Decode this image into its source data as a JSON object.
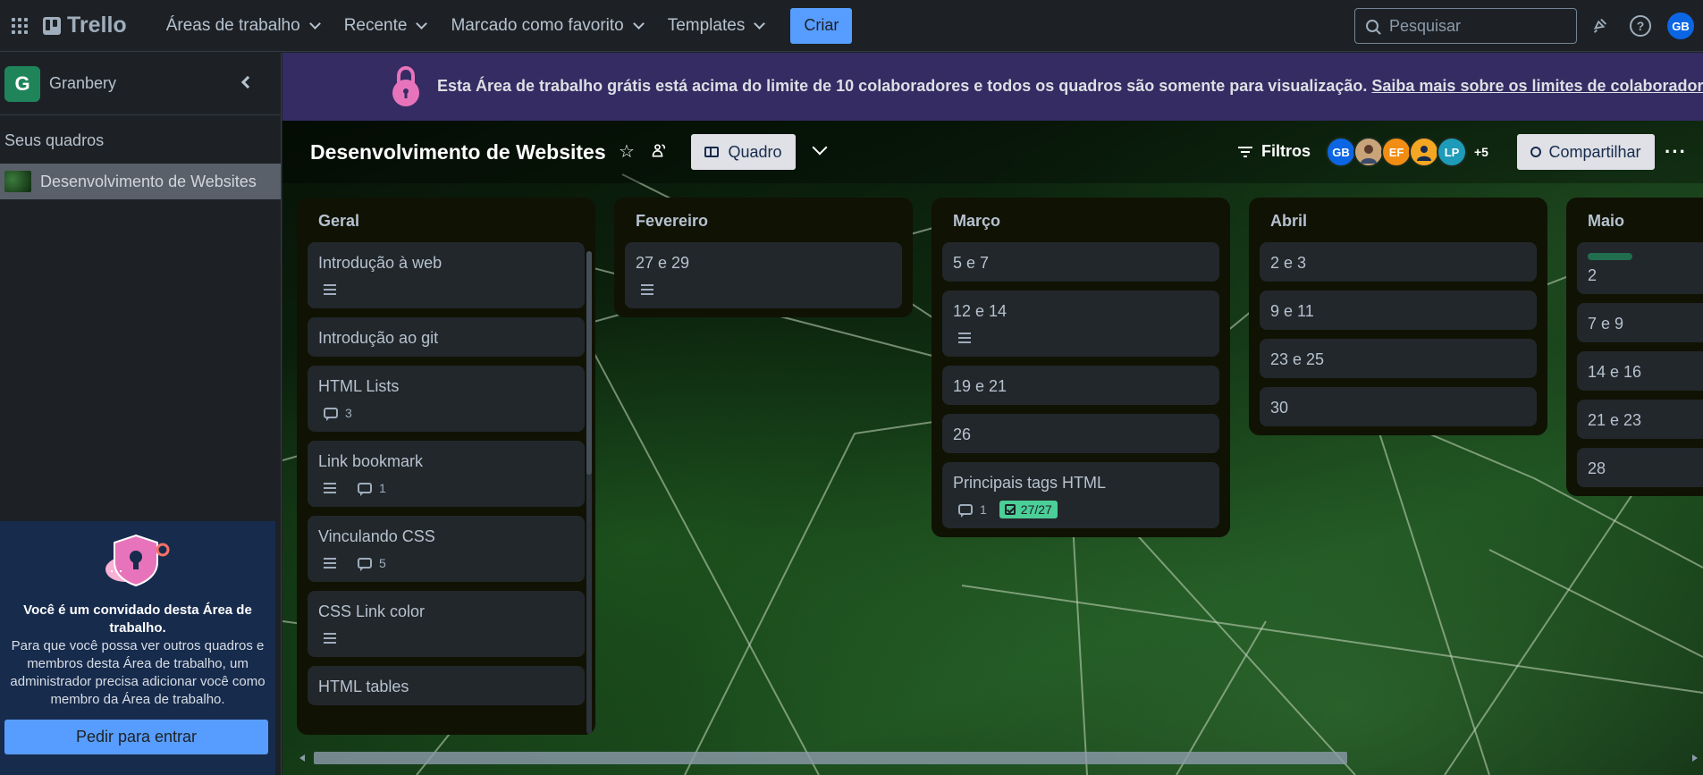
{
  "topbar": {
    "logo": "Trello",
    "menu": [
      {
        "label": "Áreas de trabalho"
      },
      {
        "label": "Recente"
      },
      {
        "label": "Marcado como favorito"
      },
      {
        "label": "Templates"
      }
    ],
    "create_label": "Criar",
    "search_placeholder": "Pesquisar",
    "user_initials": "GB"
  },
  "sidebar": {
    "workspace_initial": "G",
    "workspace_name": "Granbery",
    "section_title": "Seus quadros",
    "boards": [
      {
        "label": "Desenvolvimento de Websites"
      }
    ],
    "guest": {
      "title": "Você é um convidado desta Área de trabalho.",
      "text": "Para que você possa ver outros quadros e membros desta Área de trabalho, um administrador precisa adicionar você como membro da Área de trabalho.",
      "button": "Pedir para entrar"
    }
  },
  "banner": {
    "text": "Esta Área de trabalho grátis está acima do limite de 10 colaboradores e todos os quadros são somente para visualização.",
    "link": "Saiba mais sobre os limites de colaboradores"
  },
  "board": {
    "title": "Desenvolvimento de Websites",
    "view_label": "Quadro",
    "filters_label": "Filtros",
    "members": [
      {
        "initials": "GB",
        "color": "#0c66e4"
      },
      {
        "initials": "",
        "color": "#c9a37a"
      },
      {
        "initials": "EF",
        "color": "#f18d13"
      },
      {
        "initials": "",
        "color": "#f5a623"
      },
      {
        "initials": "LP",
        "color": "#1d9bb8"
      }
    ],
    "more_members": "+5",
    "share_label": "Compartilhar"
  },
  "lists": [
    {
      "title": "Geral",
      "cards": [
        {
          "title": "Introdução à web",
          "description": true
        },
        {
          "title": "Introdução ao git"
        },
        {
          "title": "HTML Lists",
          "comments": "3"
        },
        {
          "title": "Link bookmark",
          "description": true,
          "comments": "1"
        },
        {
          "title": "Vinculando CSS",
          "description": true,
          "comments": "5"
        },
        {
          "title": "CSS Link color",
          "description": true
        },
        {
          "title": "HTML tables"
        }
      ]
    },
    {
      "title": "Fevereiro",
      "cards": [
        {
          "title": "27 e 29",
          "description": true
        }
      ]
    },
    {
      "title": "Março",
      "cards": [
        {
          "title": "5 e 7"
        },
        {
          "title": "12 e 14",
          "description": true
        },
        {
          "title": "19 e 21"
        },
        {
          "title": "26"
        },
        {
          "title": "Principais tags HTML",
          "comments": "1",
          "checklist": "27/27"
        }
      ]
    },
    {
      "title": "Abril",
      "cards": [
        {
          "title": "2 e 3"
        },
        {
          "title": "9 e 11"
        },
        {
          "title": "23 e 25"
        },
        {
          "title": "30"
        }
      ]
    },
    {
      "title": "Maio",
      "cards": [
        {
          "title": "2",
          "label_color": "#216e4e"
        },
        {
          "title": "7 e 9"
        },
        {
          "title": "14 e 16"
        },
        {
          "title": "21 e 23"
        },
        {
          "title": "28"
        }
      ]
    }
  ]
}
